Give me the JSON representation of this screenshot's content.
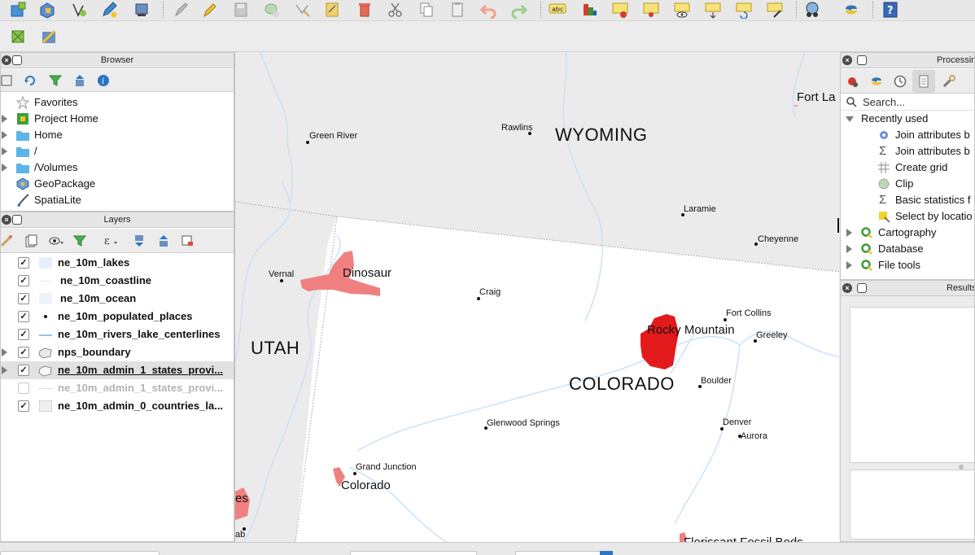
{
  "colors": {
    "accent": "#2a74c6",
    "park_fill": "#e31a1c",
    "park_light": "#f08080",
    "land_outside": "#ebebeb",
    "water": "#c5dff8"
  },
  "toolbar": {
    "icons": [
      "new-project-icon",
      "open-project-icon",
      "digitize-vertex-icon",
      "pencil-edit-icon",
      "save-layer-icon",
      "gear-tool-icon",
      "edit-brush-icon",
      "pencil-icon",
      "save-edits-icon",
      "add-point-icon",
      "vertex-tool-icon",
      "layer-edit-icon",
      "delete-icon",
      "cut-icon",
      "copy-icon",
      "paste-icon",
      "undo-icon",
      "redo-icon",
      "label-abc-icon",
      "label-pin-icon",
      "label-highlight-icon",
      "label-map-icon",
      "label-eye-icon",
      "label-move-icon",
      "label-rotate-icon",
      "label-change-icon",
      "globe-icon",
      "python-icon",
      "help-icon"
    ],
    "label_abc": "abc"
  },
  "browser": {
    "title": "Browser",
    "items": [
      {
        "label": "Favorites",
        "icon": "star-icon"
      },
      {
        "label": "Project Home",
        "icon": "project-home-icon"
      },
      {
        "label": "Home",
        "icon": "folder-icon"
      },
      {
        "label": "/",
        "icon": "folder-icon"
      },
      {
        "label": "/Volumes",
        "icon": "folder-icon"
      },
      {
        "label": "GeoPackage",
        "icon": "geopackage-icon"
      },
      {
        "label": "SpatiaLite",
        "icon": "spatialite-icon"
      }
    ]
  },
  "layers": {
    "title": "Layers",
    "items": [
      {
        "label": "ne_10m_lakes",
        "checked": true,
        "symbol": "fill-lightblue"
      },
      {
        "label": "ne_10m_coastline",
        "checked": true,
        "symbol": "line"
      },
      {
        "label": "ne_10m_ocean",
        "checked": true,
        "symbol": "fill-lightblue"
      },
      {
        "label": "ne_10m_populated_places",
        "checked": true,
        "symbol": "point"
      },
      {
        "label": "ne_10m_rivers_lake_centerlines",
        "checked": true,
        "symbol": "line-blue"
      },
      {
        "label": "nps_boundary",
        "checked": true,
        "symbol": "polygon-group"
      },
      {
        "label": "ne_10m_admin_1_states_provi...",
        "checked": true,
        "symbol": "polygon-group",
        "selected": true
      },
      {
        "label": "ne_10m_admin_1_states_provi...",
        "checked": false,
        "symbol": "line-dotted",
        "disabled": true
      },
      {
        "label": "ne_10m_admin_0_countries_la...",
        "checked": true,
        "symbol": "fill-grey"
      }
    ]
  },
  "processing": {
    "title": "Processing Toolbox",
    "title_visible": "Processin",
    "search_placeholder": "Search...",
    "tree": [
      {
        "label": "Recently used",
        "level": 0,
        "expanded": true
      },
      {
        "label": "Join attributes b",
        "level": 1,
        "icon": "gear-icon"
      },
      {
        "label": "Join attributes b",
        "level": 1,
        "icon": "sigma-icon"
      },
      {
        "label": "Create grid",
        "level": 1,
        "icon": "grid-icon"
      },
      {
        "label": "Clip",
        "level": 1,
        "icon": "clip-icon"
      },
      {
        "label": "Basic statistics f",
        "level": 1,
        "icon": "sigma-icon"
      },
      {
        "label": "Select by locatio",
        "level": 1,
        "icon": "select-location-icon"
      },
      {
        "label": "Cartography",
        "level": 0,
        "icon": "qgis-icon"
      },
      {
        "label": "Database",
        "level": 0,
        "icon": "qgis-icon"
      },
      {
        "label": "File tools",
        "level": 0,
        "icon": "qgis-icon"
      }
    ]
  },
  "results": {
    "title": "Results Viewer",
    "title_visible": "Results"
  },
  "map": {
    "states": [
      {
        "label": "WYOMING"
      },
      {
        "label": "UTAH"
      },
      {
        "label": "COLORADO"
      }
    ],
    "cities": [
      {
        "label": "Green River"
      },
      {
        "label": "Rawlins"
      },
      {
        "label": "Fort La"
      },
      {
        "label": "Laramie"
      },
      {
        "label": "Cheyenne"
      },
      {
        "label": "Vernal"
      },
      {
        "label": "Craig"
      },
      {
        "label": "Fort Collins"
      },
      {
        "label": "Greeley"
      },
      {
        "label": "Boulder"
      },
      {
        "label": "Glenwood Springs"
      },
      {
        "label": "Denver"
      },
      {
        "label": "Aurora"
      },
      {
        "label": "Grand Junction"
      },
      {
        "label": "ab"
      }
    ],
    "parks": [
      {
        "label": "Dinosaur"
      },
      {
        "label": "Rocky Mountain"
      },
      {
        "label": "Colorado"
      },
      {
        "label": "es"
      },
      {
        "label": "Florissant Fossil Beds"
      }
    ]
  }
}
